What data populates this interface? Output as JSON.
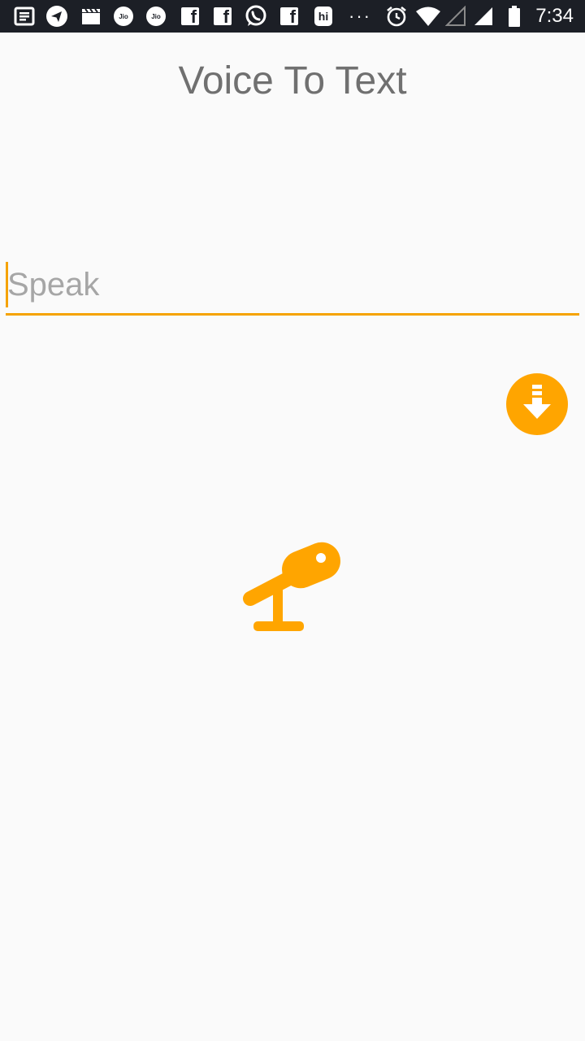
{
  "status_bar": {
    "time": "7:34",
    "jio_1": "Jio",
    "jio_2": "Jio",
    "hike_label": "hi",
    "fb_letter": "f",
    "more_dots": "···",
    "icons": [
      "news-icon",
      "telegram-icon",
      "clapperboard-icon",
      "jio-icon",
      "jio-icon",
      "facebook-icon",
      "facebook-icon",
      "whatsapp-icon",
      "facebook-icon",
      "hike-icon",
      "more-notifications-icon",
      "alarm-icon",
      "wifi-icon",
      "signal-empty-icon",
      "signal-icon",
      "battery-icon"
    ]
  },
  "header": {
    "title": "Voice To Text"
  },
  "speak_field": {
    "placeholder": "Speak",
    "value": ""
  },
  "buttons": {
    "download_icon": "download-icon",
    "mic_icon": "microphone-icon"
  },
  "colors": {
    "accent": "#ffa500",
    "underline": "#f5a300",
    "title_text": "#707070",
    "placeholder": "#a6a6a6",
    "status_bar_bg": "#1c1f26",
    "background": "#fafafa"
  }
}
